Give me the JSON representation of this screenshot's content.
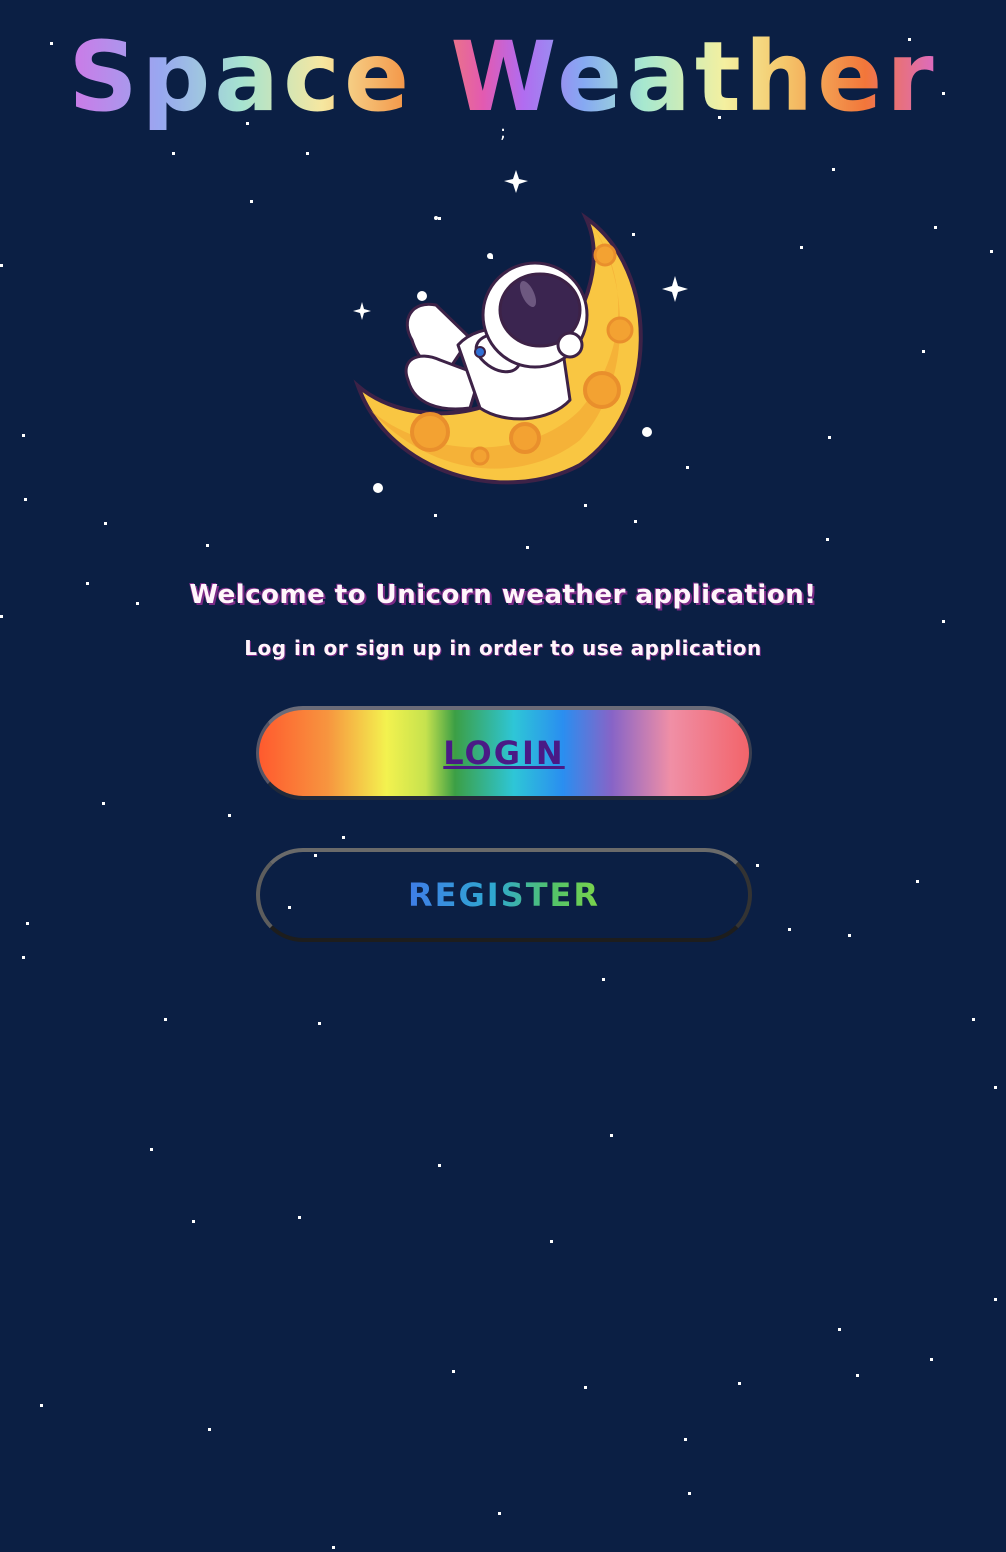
{
  "app": {
    "title": "Space Weather",
    "title_mark": ";"
  },
  "welcome": {
    "heading": "Welcome to Unicorn weather application!",
    "subheading": "Log in or sign up in order to use application"
  },
  "actions": {
    "login_label": "LOGIN",
    "register_label": "REGISTER"
  },
  "illustration": {
    "name": "astronaut-on-moon-illustration"
  },
  "colors": {
    "background": "#0b1f44",
    "moon": "#f9c642",
    "moon_shadow": "#f3a232",
    "crater": "#e98f2c",
    "suit": "#ffffff",
    "visor": "#3b2550",
    "login_text": "#4a1a86",
    "heading_shadow": "#7b2a86"
  }
}
